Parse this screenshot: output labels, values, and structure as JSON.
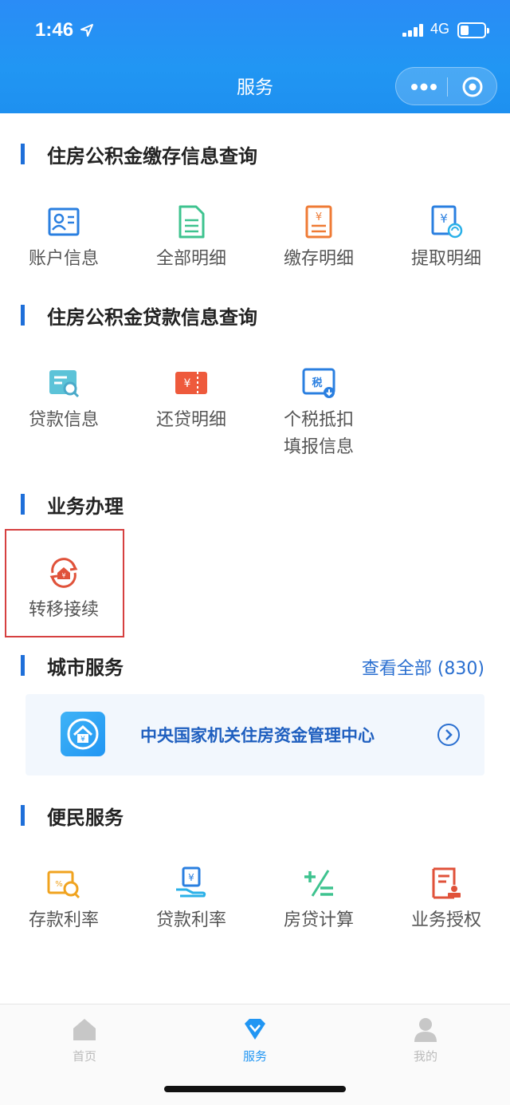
{
  "status_bar": {
    "time": "1:46",
    "network": "4G"
  },
  "header": {
    "title": "服务"
  },
  "sections": {
    "deposit": {
      "title": "住房公积金缴存信息查询",
      "items": [
        {
          "label": "账户信息",
          "icon": "account-card-icon"
        },
        {
          "label": "全部明细",
          "icon": "document-icon"
        },
        {
          "label": "缴存明细",
          "icon": "yuan-receipt-icon"
        },
        {
          "label": "提取明细",
          "icon": "withdraw-icon"
        }
      ]
    },
    "loan": {
      "title": "住房公积金贷款信息查询",
      "items": [
        {
          "label": "贷款信息",
          "icon": "loan-search-icon"
        },
        {
          "label": "还贷明细",
          "icon": "repay-ticket-icon"
        },
        {
          "label": "个税抵扣",
          "label2": "填报信息",
          "icon": "tax-icon"
        }
      ]
    },
    "business": {
      "title": "业务办理",
      "items": [
        {
          "label": "转移接续",
          "icon": "transfer-icon"
        }
      ]
    },
    "city": {
      "title": "城市服务",
      "see_all": "查看全部 (830)",
      "card_name": "中央国家机关住房资金管理中心"
    },
    "convenience": {
      "title": "便民服务",
      "items": [
        {
          "label": "存款利率",
          "icon": "deposit-rate-icon"
        },
        {
          "label": "贷款利率",
          "icon": "loan-rate-icon"
        },
        {
          "label": "房贷计算",
          "icon": "calculator-icon"
        },
        {
          "label": "业务授权",
          "icon": "authorize-icon"
        }
      ]
    }
  },
  "tabbar": {
    "home": "首页",
    "service": "服务",
    "mine": "我的"
  },
  "colors": {
    "accent": "#2196f3",
    "section_bar": "#1e6fd9",
    "highlight": "#d64040"
  }
}
